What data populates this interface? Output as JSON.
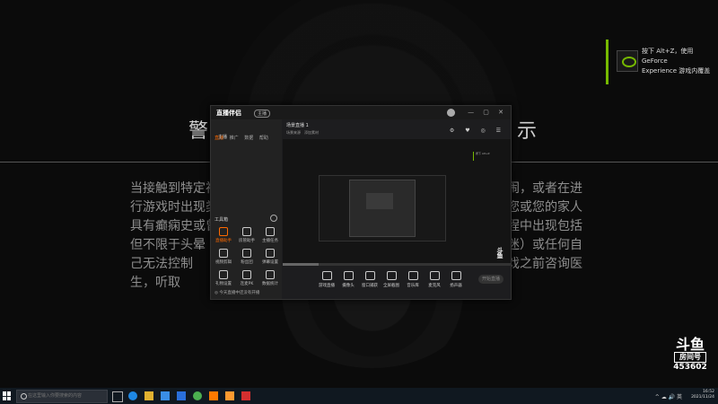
{
  "overlay": {
    "title_left": "警",
    "title_right": "示",
    "body": "当接触到特定视　　　　　　　　　　　　　　　　　　　　　　　闹，或者在进行游戏时出现类似　　　　　　　　　　　　　　　　　　　　　若您或您的家人具有癫痫史或曾　　　　　　　　　　　　　　　　　　　　　戏过程中出现包括但不限于头晕　　　　　　　　　　　　　　　　　　　　　列如昏迷）或任何自己无法控制　　　　　　　　　　　　　　　　　　　　　次进行游戏之前咨询医生，听取"
  },
  "nvidia": {
    "line1": "按下 Alt+Z，使用 GeForce",
    "line2": "Experience 游戏内覆盖",
    "accent": "#76b900"
  },
  "app": {
    "brand": "直播伴侣",
    "badge": "主播",
    "window_controls": "— ▢ ✕",
    "tabs": [
      "直播",
      "推广",
      "数据",
      "帮助"
    ],
    "user": "主播",
    "tools_label": "工具箱",
    "tools": [
      {
        "label": "直播助手",
        "icon": "assistant-icon"
      },
      {
        "label": "房管助手",
        "icon": "admin-icon"
      },
      {
        "label": "主播任务",
        "icon": "task-icon"
      },
      {
        "label": "视频剪辑",
        "icon": "video-edit-icon"
      },
      {
        "label": "粉丝团",
        "icon": "fans-icon"
      },
      {
        "label": "弹幕设置",
        "icon": "danmaku-icon"
      },
      {
        "label": "礼物设置",
        "icon": "gift-icon"
      },
      {
        "label": "连麦PK",
        "icon": "pk-icon"
      },
      {
        "label": "数据统计",
        "icon": "stats-icon"
      }
    ],
    "footer": "◎ 今天直播中还没有开播",
    "scene_title": "场景直播 1",
    "scene_sub": "场景来源　添加素材",
    "preview_overlay_text": "按下 Alt+Z",
    "bottom_buttons": [
      "游戏直播",
      "摄像头",
      "窗口捕获",
      "全屏截图",
      "音乐库",
      "麦克风",
      "扬声器"
    ],
    "live_button": "开始直播"
  },
  "douyu": {
    "logo": "斗鱼",
    "room_label": "房间号",
    "room_number": "453602"
  },
  "taskbar": {
    "search_placeholder": "在这里输入你要搜索的内容",
    "tray": "^ ☁ 🔊 英",
    "time": "16:52",
    "date": "2021/11/24"
  }
}
